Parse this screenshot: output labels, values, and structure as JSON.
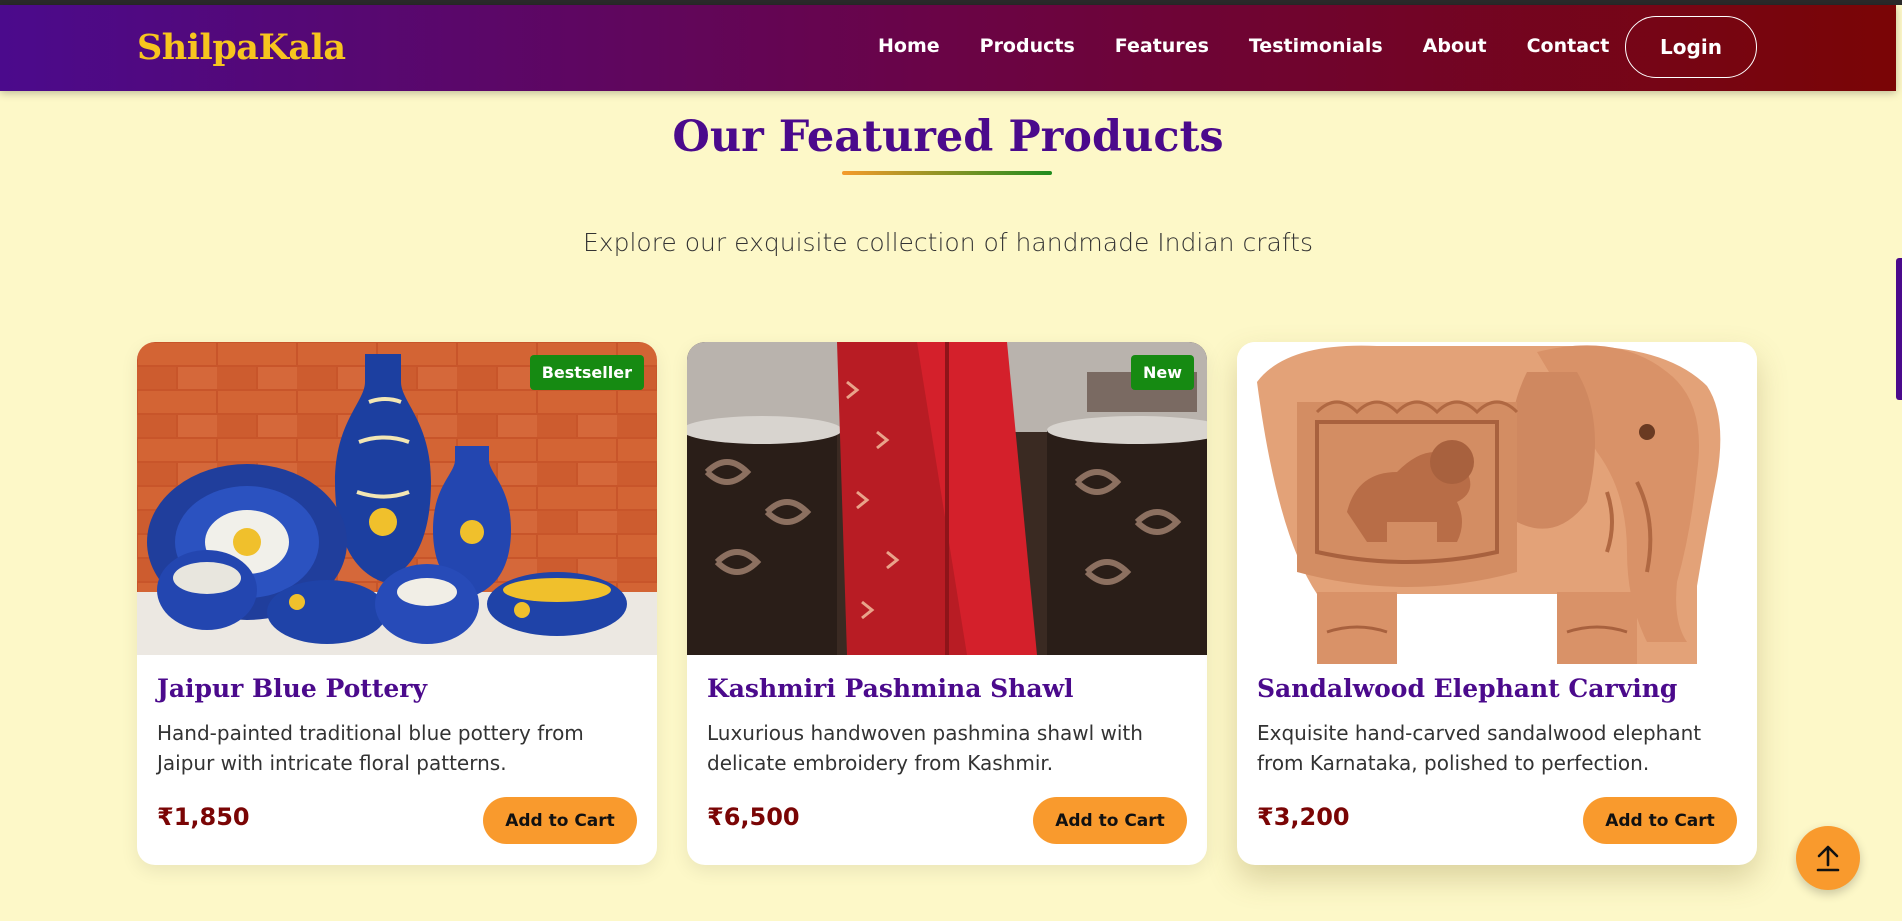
{
  "brand": {
    "name": "ShilpaKala",
    "color": "#f7c51e"
  },
  "nav": {
    "links": [
      "Home",
      "Products",
      "Features",
      "Testimonials",
      "About",
      "Contact"
    ],
    "login_label": "Login"
  },
  "section": {
    "title": "Our Featured Products",
    "subtitle": "Explore our exquisite collection of handmade Indian crafts"
  },
  "products": [
    {
      "title": "Jaipur Blue Pottery",
      "description": "Hand-painted traditional blue pottery from Jaipur with intricate floral patterns.",
      "price": "₹1,850",
      "badge": "Bestseller",
      "cart_label": "Add to Cart",
      "image_icon": "blue-pottery-image"
    },
    {
      "title": "Kashmiri Pashmina Shawl",
      "description": "Luxurious handwoven pashmina shawl with delicate embroidery from Kashmir.",
      "price": "₹6,500",
      "badge": "New",
      "cart_label": "Add to Cart",
      "image_icon": "pashmina-shawl-image"
    },
    {
      "title": "Sandalwood Elephant Carving",
      "description": "Exquisite hand-carved sandalwood elephant from Karnataka, polished to perfection.",
      "price": "₹3,200",
      "badge": "",
      "cart_label": "Add to Cart",
      "image_icon": "elephant-carving-image"
    }
  ],
  "colors": {
    "primary": "#4b0a8c",
    "accent": "#f99a2d",
    "maroon": "#7a0505",
    "badge_green": "#168a12",
    "page_bg": "#fdf8c8"
  },
  "back_to_top_icon": "arrow-up-icon"
}
